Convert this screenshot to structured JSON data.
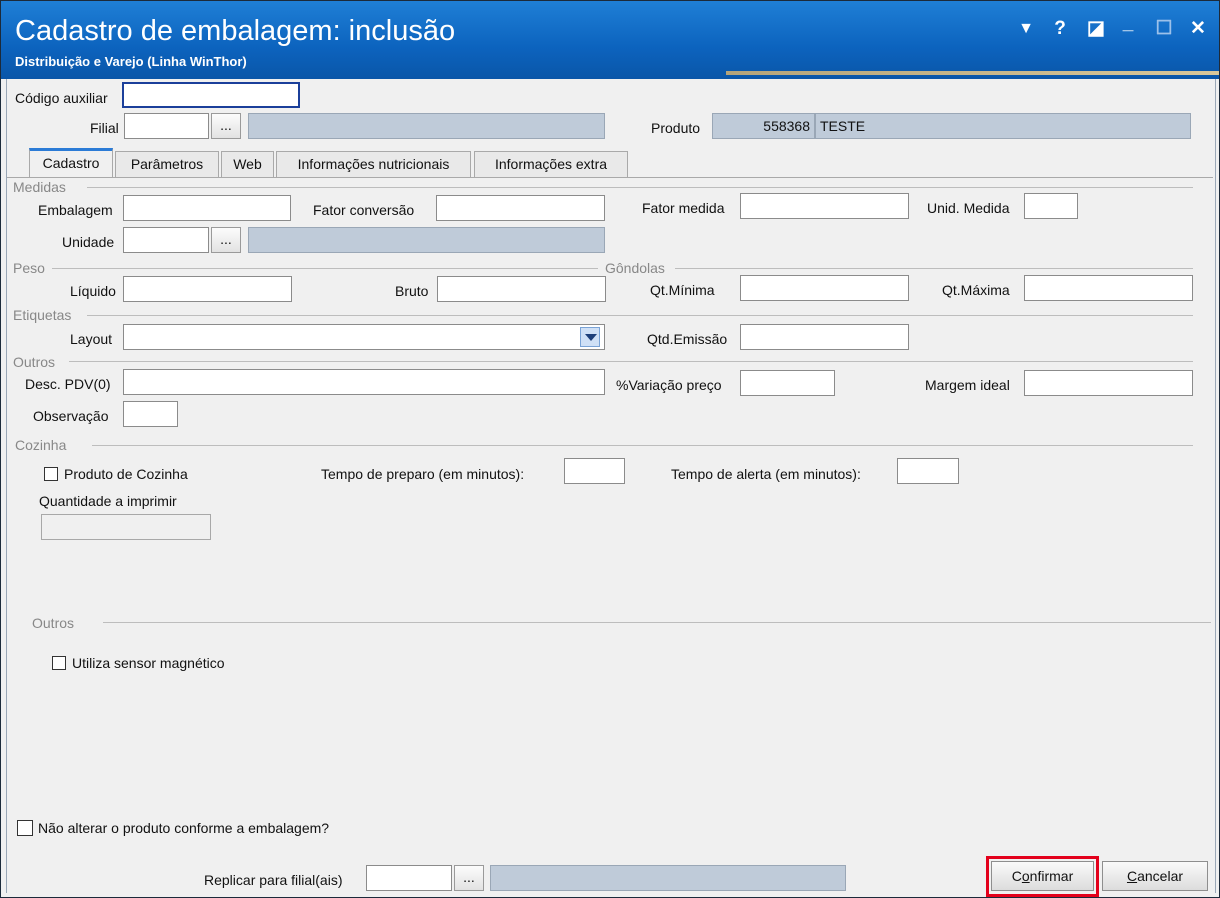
{
  "window": {
    "title": "Cadastro de embalagem: inclusão",
    "subtitle": "Distribuição e Varejo (Linha WinThor)",
    "controls": {
      "menu": "▼",
      "help": "?",
      "restore": "◪",
      "minimize": "_",
      "maximize": "☐",
      "close": "✕"
    }
  },
  "header": {
    "codigo_auxiliar_label": "Código auxiliar",
    "codigo_auxiliar_value": "",
    "filial_label": "Filial",
    "filial_value": "",
    "filial_button": "...",
    "filial_desc": "",
    "produto_label": "Produto",
    "produto_code": "558368",
    "produto_name": "TESTE"
  },
  "tabs": [
    "Cadastro",
    "Parâmetros",
    "Web",
    "Informações nutricionais",
    "Informações extra"
  ],
  "medidas": {
    "section": "Medidas",
    "embalagem_label": "Embalagem",
    "fator_conversao_label": "Fator conversão",
    "fator_medida_label": "Fator medida",
    "unid_medida_label": "Unid. Medida",
    "unidade_label": "Unidade",
    "unidade_button": "..."
  },
  "peso": {
    "section": "Peso",
    "liquido_label": "Líquido",
    "bruto_label": "Bruto"
  },
  "gondolas": {
    "section": "Gôndolas",
    "qt_minima_label": "Qt.Mínima",
    "qt_maxima_label": "Qt.Máxima"
  },
  "etiquetas": {
    "section": "Etiquetas",
    "layout_label": "Layout",
    "qtd_emissao_label": "Qtd.Emissão"
  },
  "outros": {
    "section": "Outros",
    "desc_pdv_label": "Desc. PDV(0)",
    "variacao_label": "%Variação preço",
    "margem_label": "Margem ideal",
    "observacao_label": "Observação"
  },
  "cozinha": {
    "section": "Cozinha",
    "produto_cozinha_label": "Produto de Cozinha",
    "tempo_preparo_label": "Tempo de preparo (em minutos):",
    "tempo_alerta_label": "Tempo de alerta (em minutos):",
    "quantidade_label": "Quantidade a imprimir"
  },
  "outros2": {
    "section": "Outros",
    "sensor_label": "Utiliza sensor magnético"
  },
  "footer": {
    "nao_alterar_label": "Não alterar o produto conforme a embalagem?",
    "replicar_label": "Replicar para filial(ais)",
    "replicar_button": "...",
    "confirmar_pre": "C",
    "confirmar_u": "o",
    "confirmar_post": "nfirmar",
    "cancelar_u": "C",
    "cancelar_post": "ancelar"
  },
  "colors": {
    "titlebar": "#0c63be",
    "highlight": "#e3001b",
    "readonly_field": "#bfcbd9"
  }
}
